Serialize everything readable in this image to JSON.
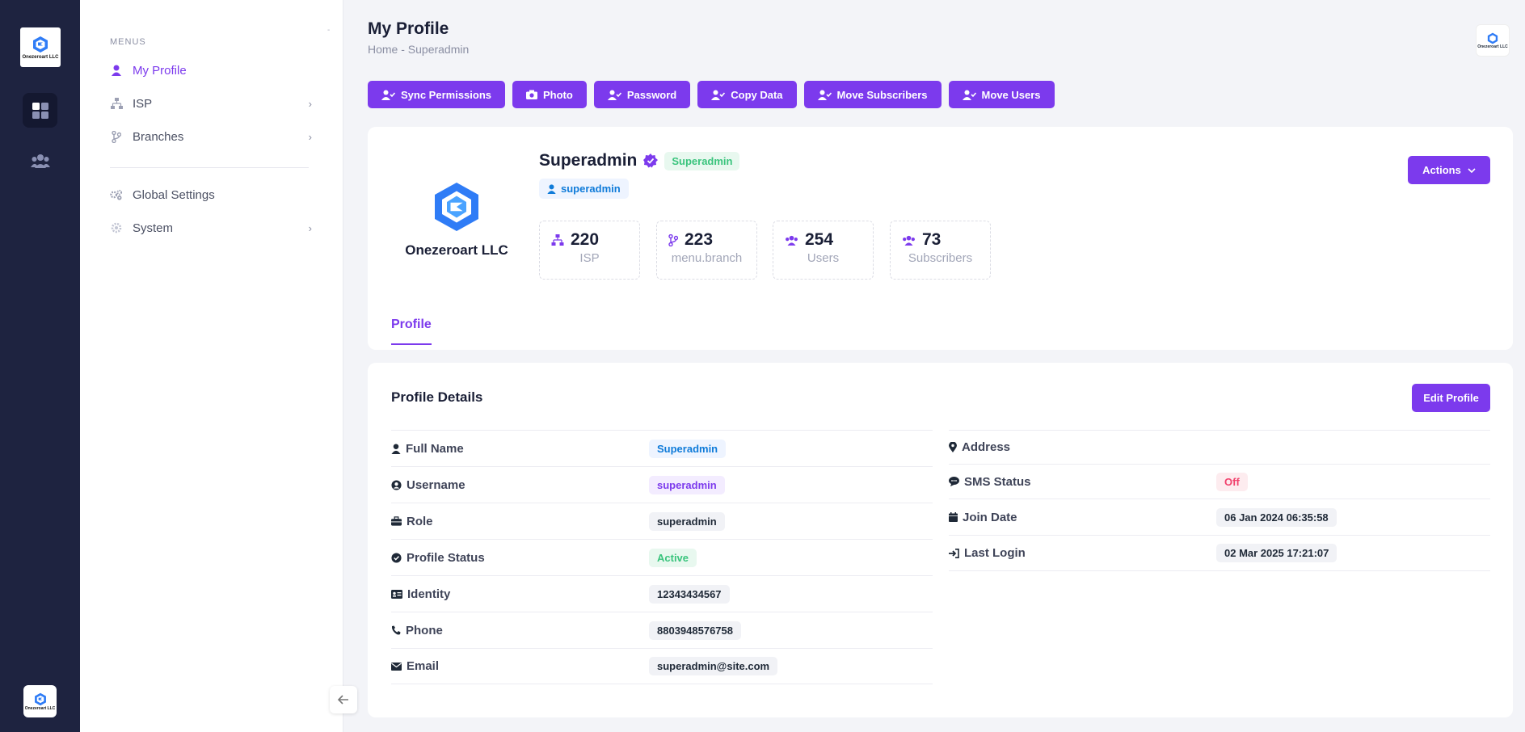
{
  "rail": {
    "logo_text": "Onezeroart LLC",
    "bottom_logo_text": "Onezeroart LLC"
  },
  "sidebar": {
    "menus_title": "MENUS",
    "items": [
      {
        "label": "My Profile",
        "icon": "user-icon"
      },
      {
        "label": "ISP",
        "icon": "network-icon"
      },
      {
        "label": "Branches",
        "icon": "branch-icon"
      },
      {
        "label": "Global Settings",
        "icon": "gears-icon"
      },
      {
        "label": "System",
        "icon": "gear-icon"
      }
    ]
  },
  "header": {
    "title": "My Profile",
    "breadcrumb": "Home  -  Superadmin",
    "avatar_text": "Onezeroart LLC"
  },
  "toolbar": {
    "sync_permissions": "Sync Permissions",
    "photo": "Photo",
    "password": "Password",
    "copy_data": "Copy Data",
    "move_subscribers": "Move Subscribers",
    "move_users": "Move Users"
  },
  "profile": {
    "org_name": "Onezeroart LLC",
    "name": "Superadmin",
    "role_badge": "Superadmin",
    "username": "superadmin",
    "actions_label": "Actions",
    "stats": [
      {
        "value": "220",
        "label": "ISP"
      },
      {
        "value": "223",
        "label": "menu.branch"
      },
      {
        "value": "254",
        "label": "Users"
      },
      {
        "value": "73",
        "label": "Subscribers"
      }
    ],
    "tab": "Profile"
  },
  "details": {
    "title": "Profile Details",
    "edit_label": "Edit Profile",
    "left": [
      {
        "label": "Full Name",
        "value": "Superadmin"
      },
      {
        "label": "Username",
        "value": "superadmin"
      },
      {
        "label": "Role",
        "value": "superadmin"
      },
      {
        "label": "Profile Status",
        "value": "Active"
      },
      {
        "label": "Identity",
        "value": "12343434567"
      },
      {
        "label": "Phone",
        "value": "8803948576758"
      },
      {
        "label": "Email",
        "value": "superadmin@site.com"
      }
    ],
    "right": [
      {
        "label": "Address",
        "value": ""
      },
      {
        "label": "SMS Status",
        "value": "Off"
      },
      {
        "label": "Join Date",
        "value": "06 Jan 2024 06:35:58"
      },
      {
        "label": "Last Login",
        "value": "02 Mar 2025 17:21:07"
      }
    ]
  },
  "colors": {
    "accent": "#7c3aed",
    "rail": "#1e2340",
    "success": "#3ac47d",
    "danger": "#f1416c",
    "info": "#0f7bd9"
  }
}
